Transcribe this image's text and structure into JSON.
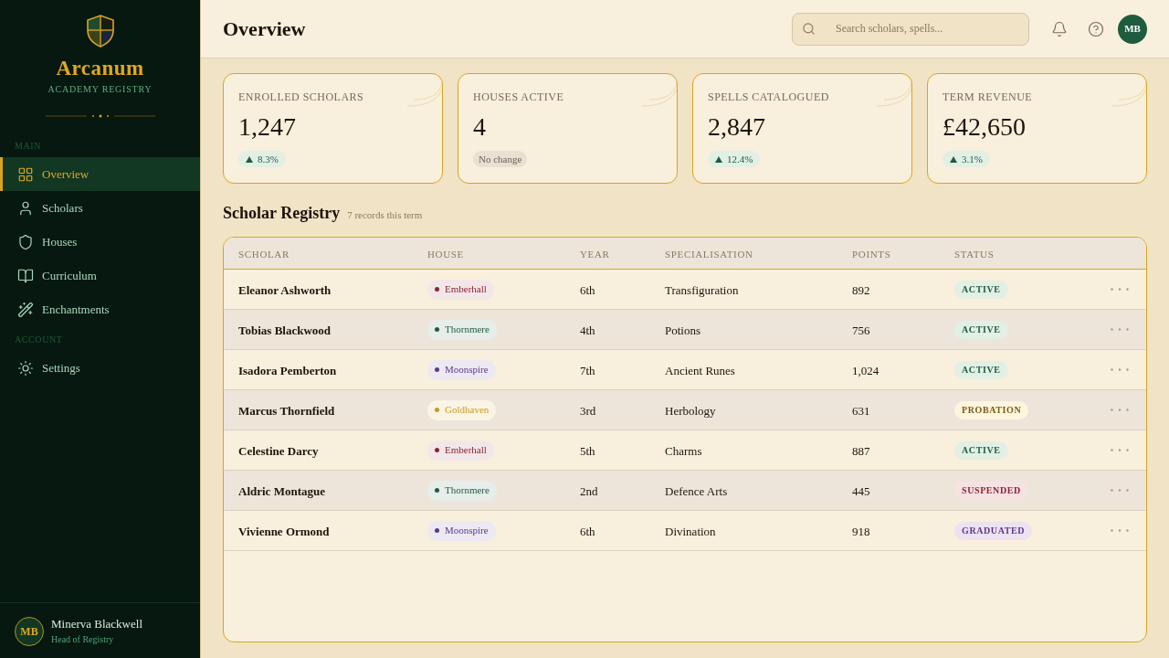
{
  "sidebar": {
    "logo": {
      "title": "Arcanum",
      "subtitle": "ACADEMY REGISTRY"
    },
    "sections": [
      {
        "label": "MAIN",
        "items": [
          {
            "label": "Overview",
            "selected": true
          },
          {
            "label": "Scholars",
            "selected": false
          },
          {
            "label": "Houses",
            "selected": false
          },
          {
            "label": "Curriculum",
            "selected": false
          },
          {
            "label": "Enchantments",
            "selected": false
          }
        ]
      },
      {
        "label": "ACCOUNT",
        "items": [
          {
            "label": "Settings",
            "selected": false
          }
        ]
      }
    ],
    "user": {
      "initials": "MB",
      "name": "Minerva Blackwell",
      "role": "Head of Registry"
    }
  },
  "header": {
    "title": "Overview",
    "search": {
      "placeholder": "Search scholars, spells..."
    },
    "avatar": "MB"
  },
  "stats": [
    {
      "label": "ENROLLED SCHOLARS",
      "value": "1,247",
      "change": {
        "kind": "up",
        "text": "8.3%"
      }
    },
    {
      "label": "HOUSES ACTIVE",
      "value": "4",
      "change": {
        "kind": "none",
        "text": "No change"
      }
    },
    {
      "label": "SPELLS CATALOGUED",
      "value": "2,847",
      "change": {
        "kind": "up",
        "text": "12.4%"
      }
    },
    {
      "label": "TERM REVENUE",
      "value": "£42,650",
      "change": {
        "kind": "up",
        "text": "3.1%"
      }
    }
  ],
  "registry": {
    "title": "Scholar Registry",
    "subtitle": "7 records this term",
    "columns": [
      "SCHOLAR",
      "HOUSE",
      "YEAR",
      "SPECIALISATION",
      "POINTS",
      "STATUS"
    ],
    "rows": [
      {
        "scholar": "Eleanor Ashworth",
        "house": {
          "name": "Emberhall",
          "color": "#8b2332"
        },
        "year": "6th",
        "specialisation": "Transfiguration",
        "points": "892",
        "status": {
          "label": "ACTIVE",
          "kind": "active"
        }
      },
      {
        "scholar": "Tobias Blackwood",
        "house": {
          "name": "Thornmere",
          "color": "#1f5c3f"
        },
        "year": "4th",
        "specialisation": "Potions",
        "points": "756",
        "status": {
          "label": "ACTIVE",
          "kind": "active"
        }
      },
      {
        "scholar": "Isadora Pemberton",
        "house": {
          "name": "Moonspire",
          "color": "#5b3a8a"
        },
        "year": "7th",
        "specialisation": "Ancient Runes",
        "points": "1,024",
        "status": {
          "label": "ACTIVE",
          "kind": "active"
        }
      },
      {
        "scholar": "Marcus Thornfield",
        "house": {
          "name": "Goldhaven",
          "color": "#c99a1a"
        },
        "year": "3rd",
        "specialisation": "Herbology",
        "points": "631",
        "status": {
          "label": "PROBATION",
          "kind": "probation"
        }
      },
      {
        "scholar": "Celestine Darcy",
        "house": {
          "name": "Emberhall",
          "color": "#8b2332"
        },
        "year": "5th",
        "specialisation": "Charms",
        "points": "887",
        "status": {
          "label": "ACTIVE",
          "kind": "active"
        }
      },
      {
        "scholar": "Aldric Montague",
        "house": {
          "name": "Thornmere",
          "color": "#1f5c3f"
        },
        "year": "2nd",
        "specialisation": "Defence Arts",
        "points": "445",
        "status": {
          "label": "SUSPENDED",
          "kind": "suspended"
        }
      },
      {
        "scholar": "Vivienne Ormond",
        "house": {
          "name": "Moonspire",
          "color": "#5b3a8a"
        },
        "year": "6th",
        "specialisation": "Divination",
        "points": "918",
        "status": {
          "label": "GRADUATED",
          "kind": "graduated"
        }
      }
    ]
  }
}
